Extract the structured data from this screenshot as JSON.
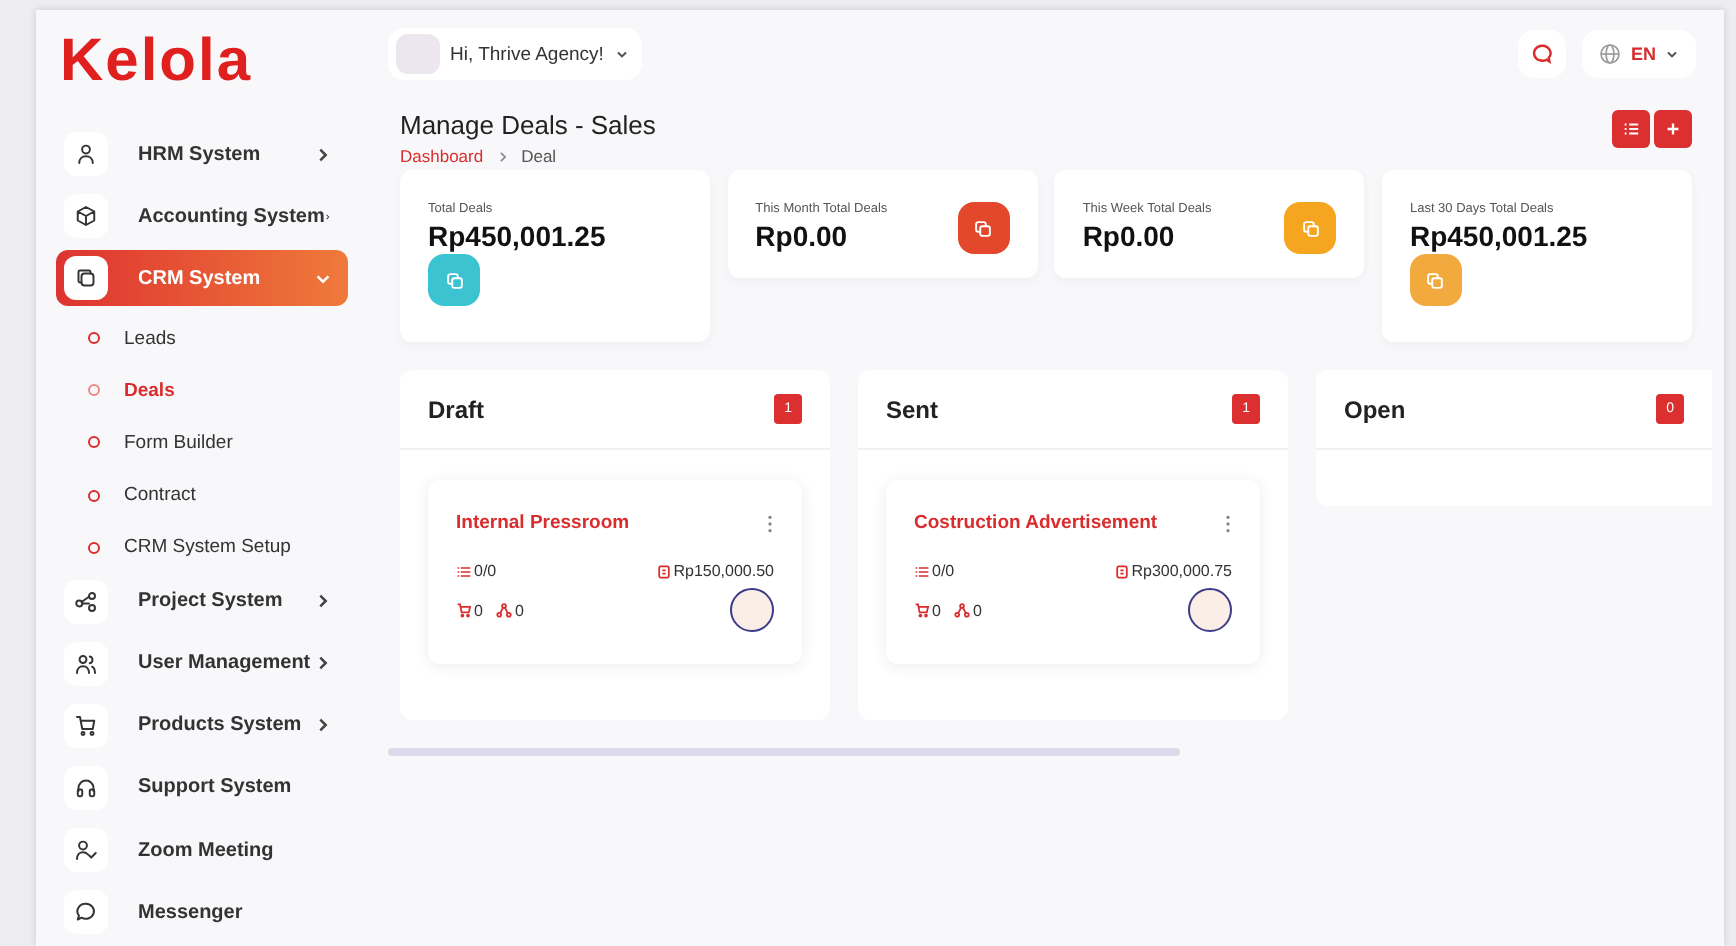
{
  "logo": "Kelola",
  "header": {
    "greeting": "Hi, Thrive Agency!",
    "language": "EN"
  },
  "sidebar": {
    "items": [
      {
        "label": "HRM System",
        "has_submenu": true,
        "expanded": false,
        "selected": false
      },
      {
        "label": "Accounting System",
        "has_submenu": true,
        "expanded": false,
        "selected": false
      },
      {
        "label": "CRM System",
        "has_submenu": true,
        "expanded": true,
        "selected": true,
        "children": [
          {
            "label": "Leads",
            "selected": false
          },
          {
            "label": "Deals",
            "selected": true
          },
          {
            "label": "Form Builder",
            "selected": false
          },
          {
            "label": "Contract",
            "selected": false
          },
          {
            "label": "CRM System Setup",
            "selected": false
          }
        ]
      },
      {
        "label": "Project System",
        "has_submenu": true,
        "expanded": false,
        "selected": false
      },
      {
        "label": "User Management",
        "has_submenu": true,
        "expanded": false,
        "selected": false
      },
      {
        "label": "Products System",
        "has_submenu": true,
        "expanded": false,
        "selected": false
      },
      {
        "label": "Support System",
        "has_submenu": false,
        "expanded": false,
        "selected": false
      },
      {
        "label": "Zoom Meeting",
        "has_submenu": false,
        "expanded": false,
        "selected": false
      },
      {
        "label": "Messenger",
        "has_submenu": false,
        "expanded": false,
        "selected": false
      }
    ]
  },
  "page": {
    "title": "Manage Deals - Sales",
    "breadcrumb": [
      "Dashboard",
      "Deal"
    ]
  },
  "stats": [
    {
      "label": "Total Deals",
      "value": "Rp450,001.25",
      "color": "#3cc3d2",
      "icon_below": true
    },
    {
      "label": "This Month Total Deals",
      "value": "Rp0.00",
      "color": "#e4482c",
      "icon_below": false
    },
    {
      "label": "This Week Total Deals",
      "value": "Rp0.00",
      "color": "#f6a521",
      "icon_below": false
    },
    {
      "label": "Last 30 Days Total Deals",
      "value": "Rp450,001.25",
      "color": "#f2aa3e",
      "icon_below": true
    }
  ],
  "stages": [
    {
      "name": "Draft",
      "count": "1",
      "deals": [
        {
          "title": "Internal Pressroom",
          "tasks": "0/0",
          "price": "Rp150,000.50",
          "products": "0",
          "sources": "0"
        }
      ]
    },
    {
      "name": "Sent",
      "count": "1",
      "deals": [
        {
          "title": "Costruction Advertisement",
          "tasks": "0/0",
          "price": "Rp300,000.75",
          "products": "0",
          "sources": "0"
        }
      ]
    },
    {
      "name": "Open",
      "count": "0"
    }
  ]
}
